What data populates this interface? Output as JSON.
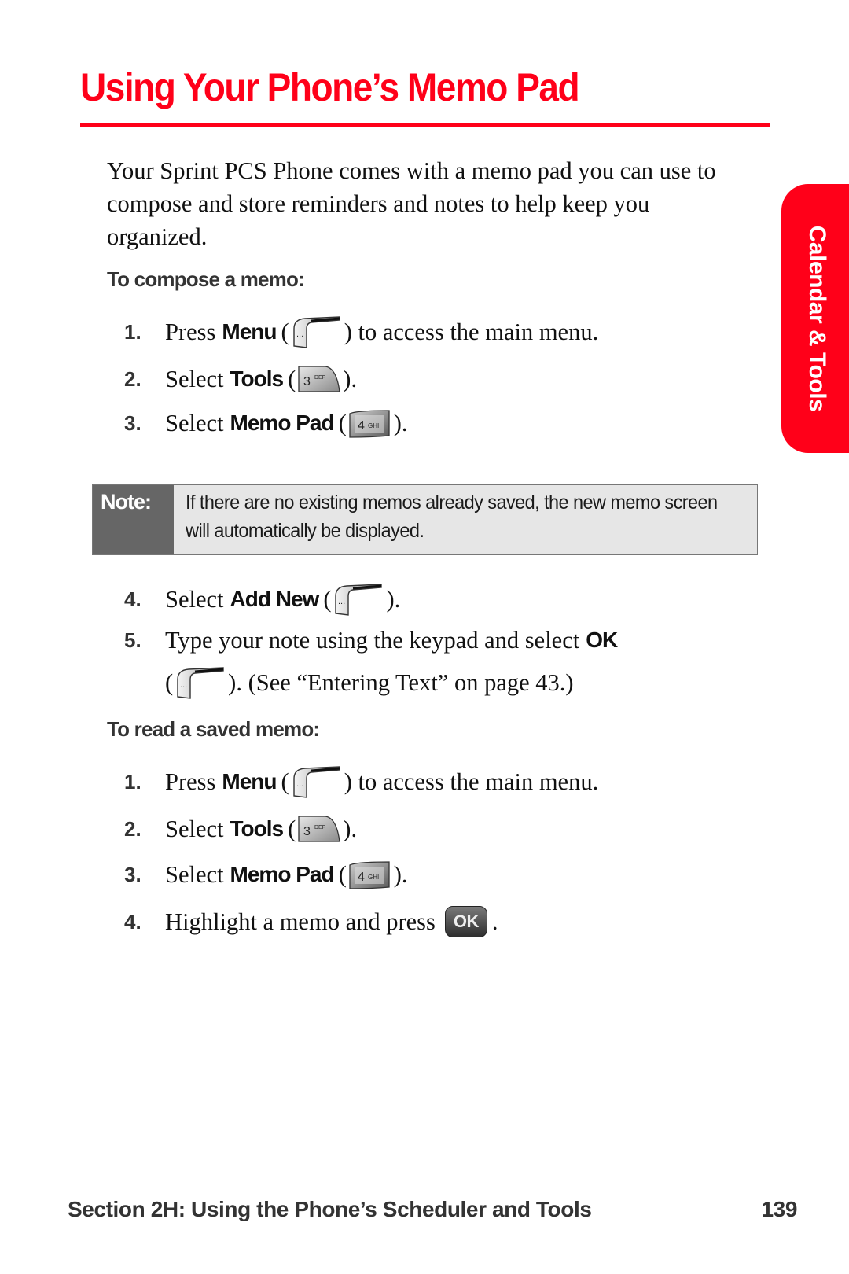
{
  "page": {
    "title": "Using Your Phone’s Memo Pad",
    "side_tab": "Calendar & Tools",
    "intro": "Your Sprint PCS Phone comes with a memo pad you can use to compose and store reminders and notes to help keep you organized.",
    "accent_color": "#ff0019"
  },
  "compose": {
    "heading": "To compose a memo:",
    "steps": [
      {
        "num": "1.",
        "pre": "Press",
        "bold": "Menu",
        "open": "(",
        "key": "menu-softkey-icon",
        "post": ") to access the main menu."
      },
      {
        "num": "2.",
        "pre": "Select",
        "bold": "Tools",
        "open": "(",
        "key": "3 DEF",
        "post": ")."
      },
      {
        "num": "3.",
        "pre": "Select",
        "bold": "Memo Pad",
        "open": "(",
        "key": "4 GHI",
        "post": ")."
      },
      {
        "num": "4.",
        "pre": "Select",
        "bold": "Add New",
        "open": "(",
        "key": "menu-softkey-icon",
        "post": ")."
      },
      {
        "num": "5.",
        "pre": "Type your note using the keypad and select",
        "bold": "OK",
        "cont_open": "(",
        "cont_post": "). (See “Entering Text” on page 43.)"
      }
    ]
  },
  "note": {
    "label": "Note:",
    "text": "If there are no existing memos already saved, the new memo screen will automatically be displayed."
  },
  "read": {
    "heading": "To read a saved memo:",
    "steps": [
      {
        "num": "1.",
        "pre": "Press",
        "bold": "Menu",
        "open": "(",
        "post": ") to access the main menu."
      },
      {
        "num": "2.",
        "pre": "Select",
        "bold": "Tools",
        "open": "(",
        "post": ")."
      },
      {
        "num": "3.",
        "pre": "Select",
        "bold": "Memo Pad",
        "open": "(",
        "post": ")."
      },
      {
        "num": "4.",
        "pre": "Highlight a memo and press",
        "okkey": "OK",
        "post": "."
      }
    ]
  },
  "keys": {
    "three_num": "3",
    "three_letters": "DEF",
    "four_num": "4",
    "four_letters": "GHI",
    "softkey_dots": "..."
  },
  "footer": {
    "section": "Section 2H: Using the Phone’s Scheduler and Tools",
    "page_number": "139"
  }
}
